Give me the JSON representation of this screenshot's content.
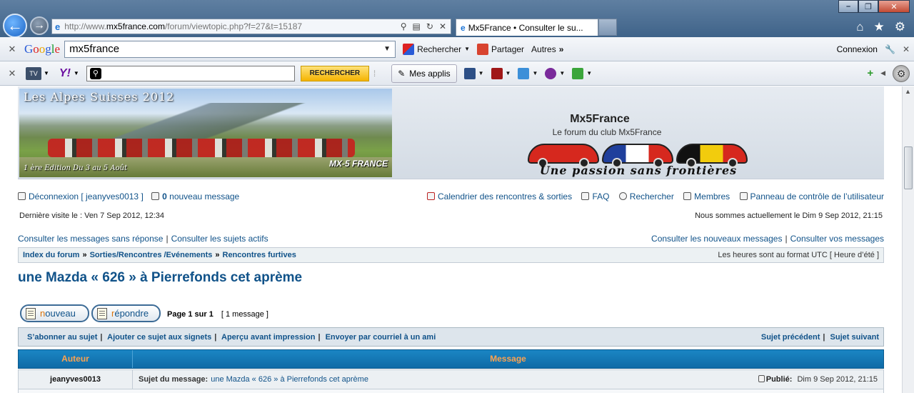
{
  "browser": {
    "url_prefix": "http://www.",
    "url_domain": "mx5france.com",
    "url_path": "/forum/viewtopic.php?f=27&t=15187",
    "tab_title": "Mx5France • Consulter le su...",
    "google_query": "mx5france",
    "google_search_label": "Rechercher",
    "share_label": "Partager",
    "more_label": "Autres",
    "login_label": "Connexion",
    "yahoo_button": "RECHERCHER",
    "my_apps_label": "Mes applis",
    "tv_label": "TV"
  },
  "header": {
    "banner_title": "Les Alpes Suisses 2012",
    "banner_subtitle": "1 ère Edition Du 3 au 5 Août",
    "banner_logo": "MX-5 FRANCE",
    "site_name": "Mx5France",
    "site_desc": "Le forum du club Mx5France",
    "tagline": "Une passion sans frontières"
  },
  "nav": {
    "logout": "Déconnexion [ jeanyves0013 ]",
    "new_count": "0",
    "new_message": "nouveau message",
    "calendar": "Calendrier des rencontres & sorties",
    "faq": "FAQ",
    "search": "Rechercher",
    "members": "Membres",
    "ucp": "Panneau de contrôle de l’utilisateur",
    "last_visit": "Dernière visite le : Ven 7 Sep 2012, 12:34",
    "current_time": "Nous sommes actuellement le Dim 9 Sep 2012, 21:15",
    "unanswered": "Consulter les messages sans réponse",
    "active": "Consulter les sujets actifs",
    "new_posts": "Consulter les nouveaux messages",
    "your_posts": "Consulter vos messages"
  },
  "breadcrumb": {
    "items": [
      "Index du forum",
      "Sorties/Rencontres /Evénements",
      "Rencontres furtives"
    ],
    "timezone": "Les heures sont au format UTC [ Heure d’été ]"
  },
  "topic": {
    "title": "une Mazda « 626 » à Pierrefonds cet aprème",
    "btn_new_first": "n",
    "btn_new_rest": "ouveau",
    "btn_reply_first": "r",
    "btn_reply_rest": "épondre",
    "page_info": "Page 1 sur 1",
    "msg_count": "[ 1 message ]"
  },
  "actions": {
    "subscribe": "S’abonner au sujet",
    "bookmark": "Ajouter ce sujet aux signets",
    "print": "Aperçu avant impression",
    "email": "Envoyer par courriel à un ami",
    "prev": "Sujet précédent",
    "next": "Sujet suivant"
  },
  "table": {
    "col_author": "Auteur",
    "col_message": "Message",
    "rows": [
      {
        "author": "jeanyves0013",
        "subject_label": "Sujet du message:",
        "subject": "une Mazda « 626 » à Pierrefonds cet aprème",
        "posted_label": "Publié:",
        "posted": "Dim 9 Sep 2012, 21:15"
      }
    ]
  },
  "colors": {
    "link": "#105289",
    "table_header": "#1b86c4",
    "header_text": "#ffa34f"
  }
}
